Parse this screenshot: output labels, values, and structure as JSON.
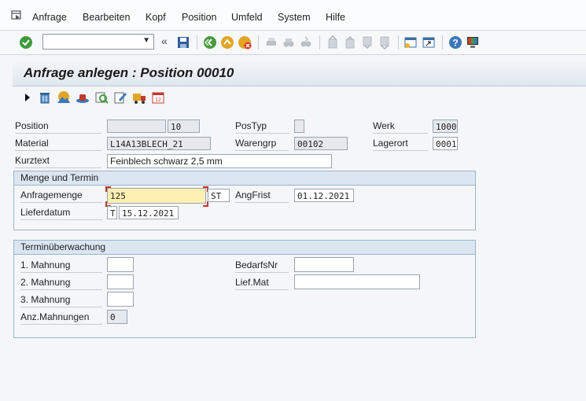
{
  "menu": {
    "items": [
      "Anfrage",
      "Bearbeiten",
      "Kopf",
      "Position",
      "Umfeld",
      "System",
      "Hilfe"
    ]
  },
  "toolbar": {
    "command_value": "",
    "enter_icon": "green-check-icon",
    "save_icon": "save-icon",
    "back_icon": "back-icon",
    "exit_icon": "exit-icon",
    "cancel_icon": "cancel-icon"
  },
  "title": "Anfrage anlegen : Position 00010",
  "form": {
    "position_label": "Position",
    "position_value": "",
    "position_value2": "10",
    "postyp_label": "PosTyp",
    "postyp_value": "",
    "werk_label": "Werk",
    "werk_value": "1000",
    "material_label": "Material",
    "material_value": "L14A13BLECH_21",
    "warengrp_label": "Warengrp",
    "warengrp_value": "00102",
    "lagerort_label": "Lagerort",
    "lagerort_value": "0001",
    "kurztext_label": "Kurztext",
    "kurztext_value": "Feinblech schwarz 2,5 mm"
  },
  "menge": {
    "title": "Menge und Termin",
    "anfragemenge_label": "Anfragemenge",
    "anfragemenge_value": "125",
    "unit_value": "ST",
    "angfrist_label": "AngFrist",
    "angfrist_value": "01.12.2021",
    "lieferdatum_label": "Lieferdatum",
    "lieferdatum_cat": "T",
    "lieferdatum_value": "15.12.2021"
  },
  "termin": {
    "title": "Terminüberwachung",
    "mahnung1_label": "1. Mahnung",
    "mahnung1_value": "",
    "mahnung2_label": "2. Mahnung",
    "mahnung2_value": "",
    "mahnung3_label": "3. Mahnung",
    "mahnung3_value": "",
    "anz_label": "Anz.Mahnungen",
    "anz_value": "0",
    "bedarfsnr_label": "BedarfsNr",
    "bedarfsnr_value": "",
    "liefmat_label": "Lief.Mat",
    "liefmat_value": ""
  }
}
